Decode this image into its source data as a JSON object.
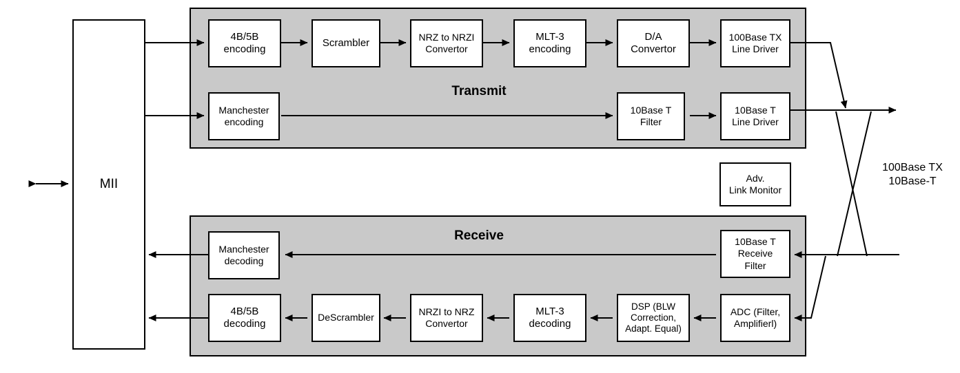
{
  "diagram": {
    "mii": {
      "label": "MII"
    },
    "transmit": {
      "title": "Transmit",
      "row1": [
        {
          "label": "4B/5B\nencoding"
        },
        {
          "label": "Scrambler"
        },
        {
          "label": "NRZ to NRZI\nConvertor"
        },
        {
          "label": "MLT-3\nencoding"
        },
        {
          "label": "D/A\nConvertor"
        },
        {
          "label": "100Base TX\nLine Driver"
        }
      ],
      "row2": [
        {
          "label": "Manchester\nencoding"
        },
        {
          "label": "10Base T\nFilter"
        },
        {
          "label": "10Base T\nLine Driver"
        }
      ]
    },
    "link_monitor": {
      "label": "Adv.\nLink Monitor"
    },
    "receive": {
      "title": "Receive",
      "row1": [
        {
          "label": "Manchester\ndecoding"
        },
        {
          "label": "10Base T\nReceive\nFilter"
        }
      ],
      "row2": [
        {
          "label": "4B/5B\ndecoding"
        },
        {
          "label": "DeScrambler"
        },
        {
          "label": "NRZI to NRZ\nConvertor"
        },
        {
          "label": "MLT-3\ndecoding"
        },
        {
          "label": "DSP (BLW\nCorrection,\nAdapt. Equal)"
        },
        {
          "label": "ADC (Filter,\nAmplifierl)"
        }
      ]
    },
    "media_label": {
      "text": "100Base TX\n10Base-T"
    },
    "colors": {
      "panel_fill": "#c9c9c9",
      "block_fill": "#ffffff",
      "line": "#000000",
      "background": "#ffffff"
    }
  }
}
